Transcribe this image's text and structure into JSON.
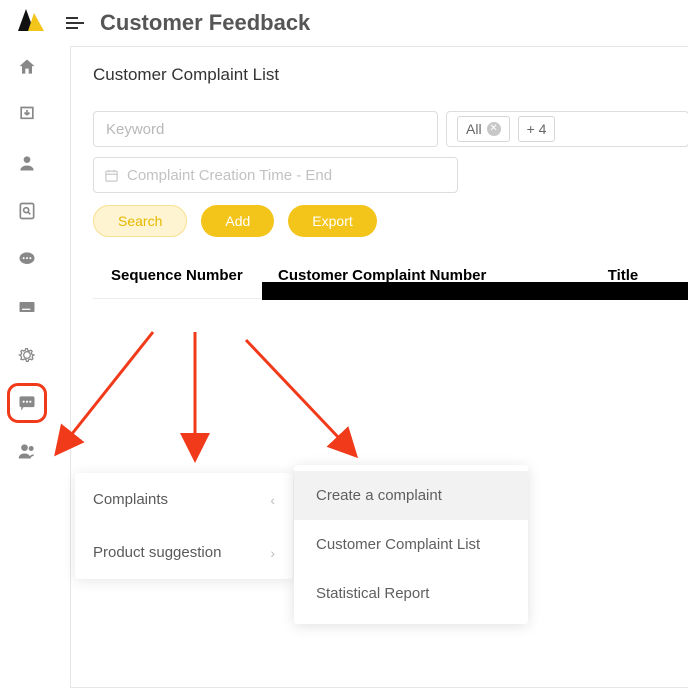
{
  "header": {
    "page_title": "Customer Feedback"
  },
  "panel": {
    "title": "Customer Complaint List",
    "keyword_placeholder": "Keyword",
    "filter": {
      "all_label": "All",
      "more_label": "+ 4"
    },
    "date_placeholder": "Complaint Creation Time - End",
    "buttons": {
      "search": "Search",
      "add": "Add",
      "export": "Export"
    },
    "columns": {
      "seq": "Sequence Number",
      "cnum": "Customer Complaint Number",
      "title": "Title"
    }
  },
  "sidebar": {
    "items": [
      {
        "name": "home"
      },
      {
        "name": "download"
      },
      {
        "name": "user"
      },
      {
        "name": "search-doc"
      },
      {
        "name": "sms"
      },
      {
        "name": "card"
      },
      {
        "name": "gear"
      },
      {
        "name": "chat"
      },
      {
        "name": "users"
      }
    ]
  },
  "flyout1": {
    "items": [
      {
        "label": "Complaints",
        "chevron": "left"
      },
      {
        "label": "Product suggestion",
        "chevron": "right"
      }
    ]
  },
  "flyout2": {
    "items": [
      {
        "label": "Create a complaint",
        "hover": true
      },
      {
        "label": "Customer Complaint List",
        "hover": false
      },
      {
        "label": "Statistical Report",
        "hover": false
      }
    ]
  }
}
